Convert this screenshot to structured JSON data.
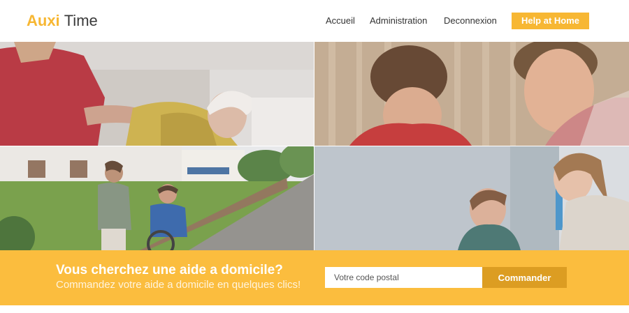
{
  "brand": {
    "name_accent": "Auxi",
    "name_rest": "Time",
    "accent_color": "#f7b733"
  },
  "nav": {
    "items": [
      {
        "label": "Accueil"
      },
      {
        "label": "Administration"
      },
      {
        "label": "Deconnexion"
      }
    ],
    "cta_label": "Help at Home"
  },
  "hero": {
    "photos": [
      {
        "subject": "caregiver holding hands with elderly woman"
      },
      {
        "subject": "smiling woman and man indoors"
      },
      {
        "subject": "woman walking beside young man in wheelchair on sidewalk"
      },
      {
        "subject": "caregiver talking with young woman"
      }
    ]
  },
  "cta": {
    "title": "Vous cherchez une aide a domicile?",
    "subtitle": "Commandez votre aide a domicile en quelques clics!",
    "postal_placeholder": "Votre code postal",
    "postal_value": "",
    "button_label": "Commander",
    "band_color": "#fbbd3e",
    "button_color": "#dc9d22"
  }
}
